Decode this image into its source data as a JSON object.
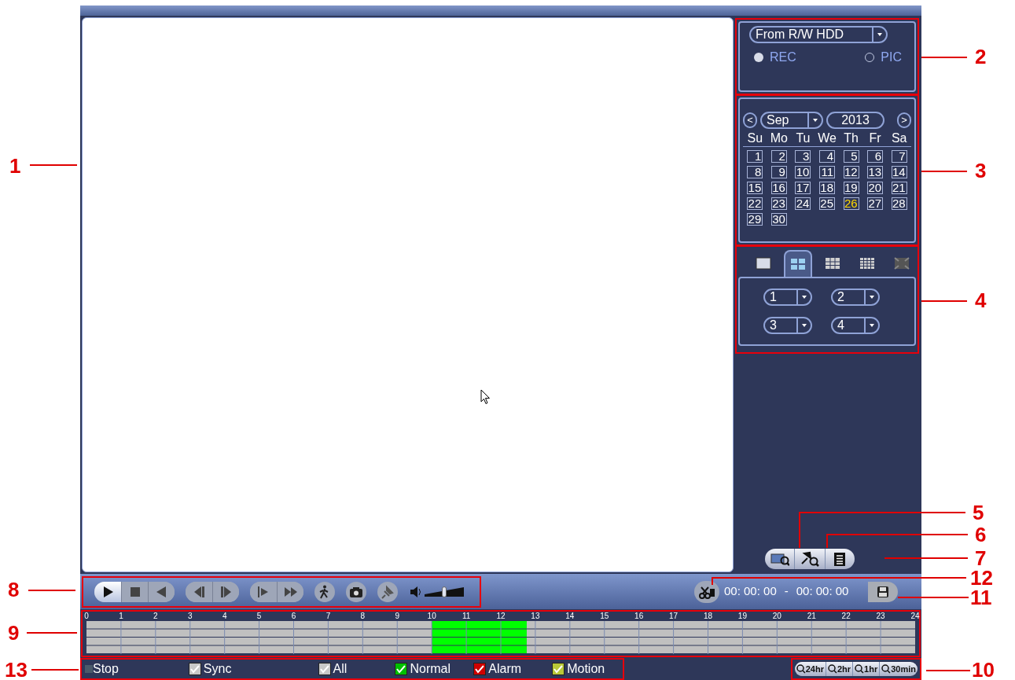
{
  "callouts": [
    {
      "label": "1"
    },
    {
      "label": "2"
    },
    {
      "label": "3"
    },
    {
      "label": "4"
    },
    {
      "label": "5"
    },
    {
      "label": "6"
    },
    {
      "label": "7"
    },
    {
      "label": "8"
    },
    {
      "label": "12"
    },
    {
      "label": "11"
    },
    {
      "label": "9"
    },
    {
      "label": "13"
    },
    {
      "label": "10"
    }
  ],
  "source": {
    "value": "From R/W HDD"
  },
  "record_types": [
    {
      "label": "REC",
      "selected": true
    },
    {
      "label": "PIC",
      "selected": false
    }
  ],
  "calendar": {
    "prev": "<",
    "month": "Sep",
    "year": "2013",
    "next": ">",
    "weekdays": [
      "Su",
      "Mo",
      "Tu",
      "We",
      "Th",
      "Fr",
      "Sa"
    ],
    "days": [
      {
        "label": "1",
        "selected": false
      },
      {
        "label": "2",
        "selected": false
      },
      {
        "label": "3",
        "selected": false
      },
      {
        "label": "4",
        "selected": false
      },
      {
        "label": "5",
        "selected": false
      },
      {
        "label": "6",
        "selected": false
      },
      {
        "label": "7",
        "selected": false
      },
      {
        "label": "8",
        "selected": false
      },
      {
        "label": "9",
        "selected": false
      },
      {
        "label": "10",
        "selected": false
      },
      {
        "label": "11",
        "selected": false
      },
      {
        "label": "12",
        "selected": false
      },
      {
        "label": "13",
        "selected": false
      },
      {
        "label": "14",
        "selected": false
      },
      {
        "label": "15",
        "selected": false
      },
      {
        "label": "16",
        "selected": false
      },
      {
        "label": "17",
        "selected": false
      },
      {
        "label": "18",
        "selected": false
      },
      {
        "label": "19",
        "selected": false
      },
      {
        "label": "20",
        "selected": false
      },
      {
        "label": "21",
        "selected": false
      },
      {
        "label": "22",
        "selected": false
      },
      {
        "label": "23",
        "selected": false
      },
      {
        "label": "24",
        "selected": false
      },
      {
        "label": "25",
        "selected": false
      },
      {
        "label": "26",
        "selected": true
      },
      {
        "label": "27",
        "selected": false
      },
      {
        "label": "28",
        "selected": false
      },
      {
        "label": "29",
        "selected": false
      },
      {
        "label": "30",
        "selected": false
      }
    ]
  },
  "split_modes": [
    {
      "kind": "single",
      "selected": false
    },
    {
      "kind": "quad",
      "selected": true
    },
    {
      "kind": "nine",
      "selected": false
    },
    {
      "kind": "sixteen",
      "selected": false
    },
    {
      "kind": "fullscreen",
      "selected": false
    }
  ],
  "channels": [
    "1",
    "2",
    "3",
    "4"
  ],
  "search_buttons": [
    {
      "kind": "card"
    },
    {
      "kind": "mark"
    },
    {
      "kind": "list"
    }
  ],
  "playback_buttons": [
    {
      "kind": "play",
      "selected": true
    },
    {
      "kind": "stop",
      "selected": false
    },
    {
      "kind": "reverse",
      "selected": false
    },
    {
      "kind": "prev_frame",
      "selected": false
    },
    {
      "kind": "next_frame",
      "selected": false
    },
    {
      "kind": "slow",
      "selected": false
    },
    {
      "kind": "fast",
      "selected": false
    },
    {
      "kind": "smart",
      "selected": false
    },
    {
      "kind": "snapshot",
      "selected": false
    },
    {
      "kind": "mark",
      "selected": false
    }
  ],
  "volume": {
    "level": 0.5
  },
  "clip": {
    "start": "00: 00: 00",
    "separator": "-",
    "end": "00: 00: 00"
  },
  "timeline": {
    "chart_data": {
      "type": "bar",
      "orientation": "horizontal",
      "stacked": true,
      "grid": true,
      "xlim": [
        0,
        24
      ],
      "xticks": [
        0,
        1,
        2,
        3,
        4,
        5,
        6,
        7,
        8,
        9,
        10,
        11,
        12,
        13,
        14,
        15,
        16,
        17,
        18,
        19,
        20,
        21,
        22,
        23,
        24
      ],
      "series": [
        {
          "color": "#c0c0c0",
          "values": [
            10,
            10,
            10,
            10
          ]
        },
        {
          "color": "#00ff00",
          "values": [
            2.75,
            2.75,
            2.75,
            2.75
          ]
        },
        {
          "color": "#c0c0c0",
          "values": [
            11.25,
            11.25,
            11.25,
            11.25
          ]
        }
      ]
    }
  },
  "status": {
    "label": "Stop"
  },
  "filters": [
    {
      "label": "Sync",
      "checked": true,
      "color": "#c8c8c8"
    },
    {
      "label": "All",
      "checked": true,
      "color": "#c8c8c8"
    },
    {
      "label": "Normal",
      "checked": true,
      "color": "#00c000"
    },
    {
      "label": "Alarm",
      "checked": true,
      "color": "#d00000"
    },
    {
      "label": "Motion",
      "checked": true,
      "color": "#b8c838"
    }
  ],
  "zoom_buttons": [
    {
      "label": "24hr"
    },
    {
      "label": "2hr"
    },
    {
      "label": "1hr"
    },
    {
      "label": "30min"
    }
  ]
}
